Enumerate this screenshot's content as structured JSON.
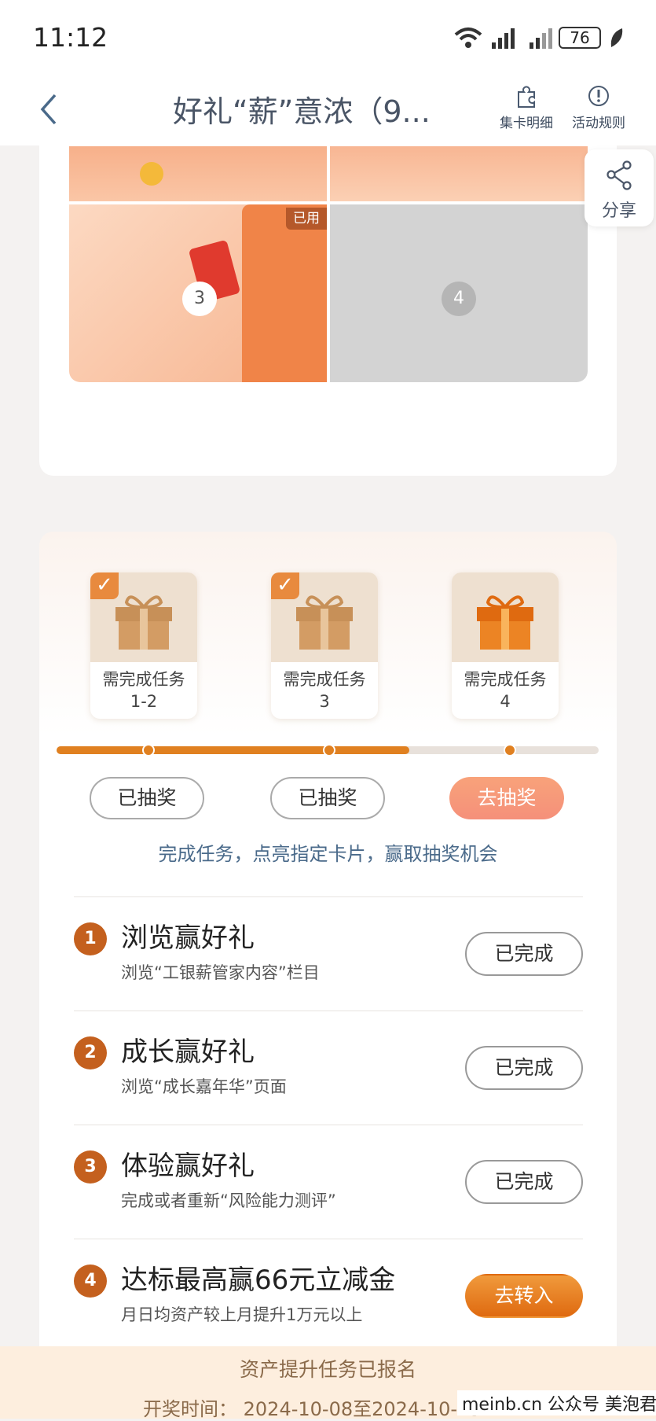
{
  "status": {
    "time": "11:12",
    "battery": "76"
  },
  "nav": {
    "title": "好礼“薪”意浓（9...",
    "detail_label": "集卡明细",
    "rules_label": "活动规则"
  },
  "share": {
    "label": "分享"
  },
  "cards": {
    "used_badge": "已用",
    "card3": "3",
    "card4": "4"
  },
  "gifts": [
    {
      "label": "需完成任务",
      "tasks": "1-2"
    },
    {
      "label": "需完成任务",
      "tasks": "3"
    },
    {
      "label": "需完成任务",
      "tasks": "4"
    }
  ],
  "progress": 0.65,
  "draw_buttons": [
    "已抽奖",
    "已抽奖",
    "去抽奖"
  ],
  "hint": "完成任务，点亮指定卡片，赢取抽奖机会",
  "tasks": [
    {
      "num": "1",
      "name": "浏览赢好礼",
      "desc": "浏览“工银薪管家内容”栏目",
      "button": "已完成"
    },
    {
      "num": "2",
      "name": "成长赢好礼",
      "desc": "浏览“成长嘉年华”页面",
      "button": "已完成"
    },
    {
      "num": "3",
      "name": "体验赢好礼",
      "desc": "完成或者重新“风险能力测评”",
      "button": "已完成"
    },
    {
      "num": "4",
      "name": "达标最高赢66元立减金",
      "desc": "月日均资产较上月提升1万元以上",
      "button": "去转入"
    }
  ],
  "footer": {
    "line1": "资产提升任务已报名",
    "line2_label": "开奖时间：",
    "line2_value": "2024-10-08至2024-10-15"
  },
  "watermark": {
    "site": "meinb.cn",
    "account": "公众号 美泡君"
  },
  "colors": {
    "accent": "#df6a10",
    "card_orange": "#f5b58f",
    "text_blue": "#4a6a8a"
  }
}
